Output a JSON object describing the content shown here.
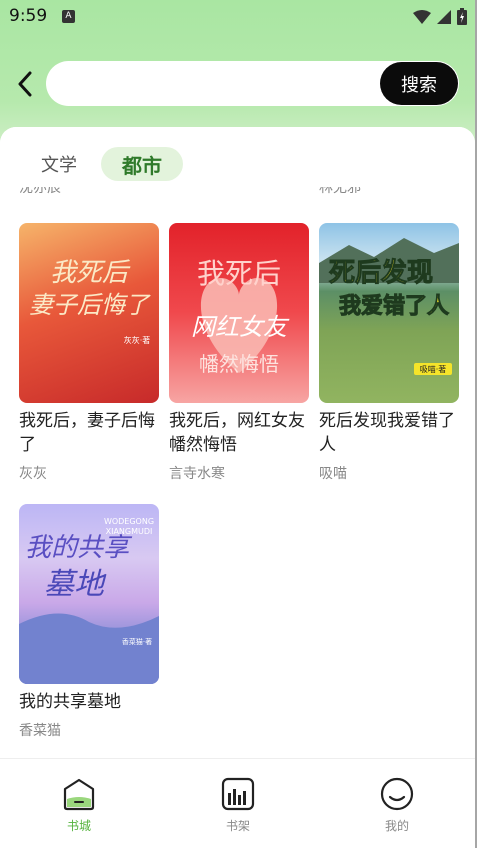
{
  "status_bar": {
    "time": "9:59",
    "notification_letter": "A"
  },
  "search": {
    "placeholder": "",
    "value": "",
    "button_label": "搜索"
  },
  "tabs": [
    {
      "label": "文学",
      "active": false
    },
    {
      "label": "都市",
      "active": true
    }
  ],
  "clipped_authors": [
    "沈亦辰",
    "林无邪"
  ],
  "books": [
    {
      "title": "我死后，妻子后悔了",
      "author": "灰灰",
      "cover_text": "我死后妻子后悔了",
      "cover_badge": "灰灰·著"
    },
    {
      "title": "我死后，网红女友幡然悔悟",
      "author": "言寺水寒",
      "cover_text": "我死后 网红女友 幡然悔悟"
    },
    {
      "title": "死后发现我爱错了人",
      "author": "吸喵",
      "cover_text": "死后发现 我爱错了人",
      "cover_badge": "吸喵·著"
    },
    {
      "title": "我的共享墓地",
      "author": "香菜猫",
      "cover_text": "我的共享墓地",
      "cover_subtitle": "WODEGONG XIANGMUDI",
      "cover_badge": "香菜猫·著"
    }
  ],
  "bottom_nav": [
    {
      "label": "书城",
      "icon": "bookstore-icon",
      "active": true
    },
    {
      "label": "书架",
      "icon": "bookshelf-icon",
      "active": false
    },
    {
      "label": "我的",
      "icon": "profile-icon",
      "active": false
    }
  ],
  "colors": {
    "accent_green": "#54b33c",
    "tab_active_bg": "#e3f3dc",
    "search_button_bg": "#0b0b0b"
  }
}
